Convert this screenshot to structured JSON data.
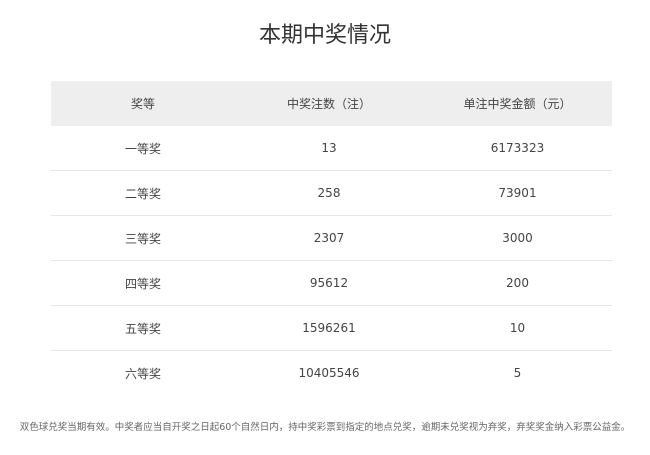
{
  "title": "本期中奖情况",
  "table": {
    "headers": [
      "奖等",
      "中奖注数（注）",
      "单注中奖金额（元）"
    ],
    "rows": [
      [
        "一等奖",
        "13",
        "6173323"
      ],
      [
        "二等奖",
        "258",
        "73901"
      ],
      [
        "三等奖",
        "2307",
        "3000"
      ],
      [
        "四等奖",
        "95612",
        "200"
      ],
      [
        "五等奖",
        "1596261",
        "10"
      ],
      [
        "六等奖",
        "10405546",
        "5"
      ]
    ]
  },
  "footnote": "双色球兑奖当期有效。中奖者应当自开奖之日起60个自然日内，持中奖彩票到指定的地点兑奖，逾期未兑奖视为弃奖，弃奖奖金纳入彩票公益金。"
}
